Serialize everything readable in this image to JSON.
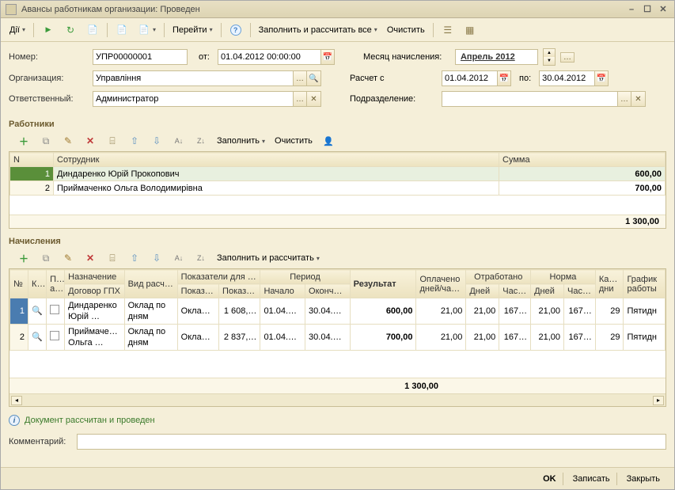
{
  "window": {
    "title": "Авансы работникам организации: Проведен"
  },
  "toolbar": {
    "actions_label": "Дії",
    "goto_label": "Перейти",
    "fill_calc_label": "Заполнить и рассчитать все",
    "clear_label": "Очистить"
  },
  "form": {
    "number_label": "Номер:",
    "number_value": "УПР00000001",
    "from_label": "от:",
    "from_value": "01.04.2012 00:00:00",
    "org_label": "Организация:",
    "org_value": "Управління",
    "resp_label": "Ответственный:",
    "resp_value": "Администратор",
    "month_label": "Месяц начисления:",
    "month_value": "Апрель 2012",
    "calc_from_label": "Расчет с",
    "calc_from_value": "01.04.2012",
    "po_label": "по:",
    "po_value": "30.04.2012",
    "subdiv_label": "Подразделение:",
    "subdiv_value": ""
  },
  "workers": {
    "title": "Работники",
    "tb_fill": "Заполнить",
    "tb_clear": "Очистить",
    "cols": {
      "n": "N",
      "emp": "Сотрудник",
      "sum": "Сумма"
    },
    "rows": [
      {
        "n": "1",
        "emp": "Диндаренко Юрій Прокопович",
        "sum": "600,00"
      },
      {
        "n": "2",
        "emp": "Приймаченко Ольга Володимирівна",
        "sum": "700,00"
      }
    ],
    "total": "1 300,00"
  },
  "accruals": {
    "title": "Начисления",
    "tb_fill": "Заполнить и рассчитать",
    "cols_top": {
      "n": "№",
      "k": "К…",
      "pa": "П…\nа…",
      "assign": "Назначение",
      "calc_type": "Вид расчета",
      "indic": "Показатели для р…",
      "period": "Период",
      "result": "Результат",
      "paid": "Оплачено дней/ча…",
      "worked": "Отработано",
      "norm": "Норма",
      "caldays": "Кал…\nдни",
      "schedule": "График работы"
    },
    "cols_sub": {
      "assign2": "Договор ГПХ",
      "indic1": "Показ…",
      "indic2": "Показ…",
      "per1": "Начало",
      "per2": "Оконча…",
      "w_days": "Дней",
      "w_hours": "Час…",
      "n_days": "Дней",
      "n_hours": "Час…"
    },
    "rows": [
      {
        "n": "1",
        "assign": "Диндаренко Юрій …",
        "calc_type": "Оклад по дням",
        "ind1": "Оклад/…",
        "ind2": "1 608,…",
        "p1": "01.04.2…",
        "p2": "30.04.2…",
        "result": "600,00",
        "paid": "21,00",
        "wd": "21,00",
        "wh": "167…",
        "nd": "21,00",
        "nh": "167…",
        "cd": "29",
        "sched": "Пятидн"
      },
      {
        "n": "2",
        "assign": "Приймачен… Ольга …",
        "calc_type": "Оклад по дням",
        "ind1": "Оклад/…",
        "ind2": "2 837,…",
        "p1": "01.04.2…",
        "p2": "30.04.2…",
        "result": "700,00",
        "paid": "21,00",
        "wd": "21,00",
        "wh": "167…",
        "nd": "21,00",
        "nh": "167…",
        "cd": "29",
        "sched": "Пятидн"
      }
    ],
    "total_result": "1 300,00"
  },
  "status": {
    "text": "Документ рассчитан и проведен"
  },
  "comment": {
    "label": "Комментарий:",
    "value": ""
  },
  "footer": {
    "ok": "OK",
    "save": "Записать",
    "close": "Закрыть"
  }
}
